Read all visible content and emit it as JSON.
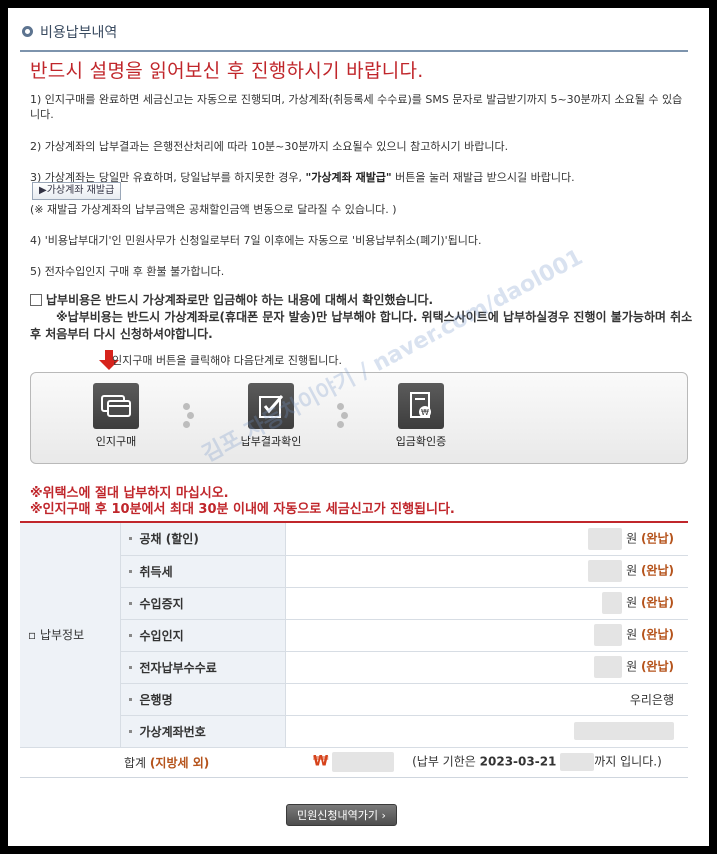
{
  "section_title": "비용납부내역",
  "headline": "반드시 설명을 읽어보신 후 진행하시기 바랍니다.",
  "notes": {
    "n1": "1) 인지구매를 완료하면 세금신고는 자동으로 진행되며, 가상계좌(취등록세 수수료)를 SMS 문자로 발급받기까지 5~30분까지 소요될 수 있습니다.",
    "n2": "2) 가상계좌의 납부결과는 은행전산처리에 따라 10분~30분까지 소요될수 있으니 참고하시기 바랍니다.",
    "n3_a": "3) 가상계좌는 당일만 유효하며, 당일납부를 하지못한 경우,",
    "n3_b": "\"가상계좌 재발급\"",
    "n3_c": "버튼을 눌러 재발급 받으시길 바랍니다.",
    "n3_sub": "(※ 재발급 가상계좌의 납부금액은 공채할인금액 변동으로 달라질 수 있습니다. )",
    "n4": "4) '비용납부대기'인 민원사무가 신청일로부터 7일 이후에는 자동으로 '비용납부취소(폐기)'됩니다.",
    "n5": "5) 전자수입인지 구매 후 환불 불가합니다."
  },
  "reissue_button": "▶가상계좌 재발급",
  "confirm": {
    "line1": "납부비용은 반드시 가상계좌로만 입금해야 하는 내용에 대해서 확인했습니다.",
    "line2": "※납부비용는 반드시 가상계좌로(휴대폰 문자 발송)만 납부해야 합니다. 위택스사이트에 납부하실경우 진행이 불가능하며 취소후 처음부터 다시 신청하셔야합니다."
  },
  "guide_text": "인지구매 버튼을 클릭해야 다음단계로 진행됩니다.",
  "steps": [
    {
      "label": "인지구매"
    },
    {
      "label": "납부결과확인"
    },
    {
      "label": "입금확인증"
    }
  ],
  "warnings": {
    "w1": "※위택스에 절대 납부하지 마십시오.",
    "w2": "※인지구매 후 10분에서 최대 30분 이내에 자동으로 세금신고가 진행됩니다."
  },
  "table": {
    "group_label": "납부정보",
    "rows": [
      {
        "label": "공채 (할인)",
        "unit": "원",
        "status": "(완납)"
      },
      {
        "label": "취득세",
        "unit": "원",
        "status": "(완납)"
      },
      {
        "label": "수입증지",
        "unit": "원",
        "status": "(완납)"
      },
      {
        "label": "수입인지",
        "unit": "원",
        "status": "(완납)"
      },
      {
        "label": "전자납부수수료",
        "unit": "원",
        "status": "(완납)"
      },
      {
        "label": "은행명",
        "value": "우리은행"
      },
      {
        "label": "가상계좌번호",
        "value": ""
      }
    ],
    "total_label": "합계",
    "total_sub": "(지방세 외)",
    "won_symbol": "₩",
    "deadline_prefix": "(납부 기한은",
    "deadline_date": "2023-03-21",
    "deadline_suffix": "까지 입니다.)"
  },
  "footer_button": "민원신청내역가기 ›",
  "watermark": "김포 자동차이야기 / naver.com/daol001",
  "colors": {
    "accent_red": "#c0262b",
    "paid_orange": "#b5531b",
    "header_blue": "#7d94ad"
  }
}
